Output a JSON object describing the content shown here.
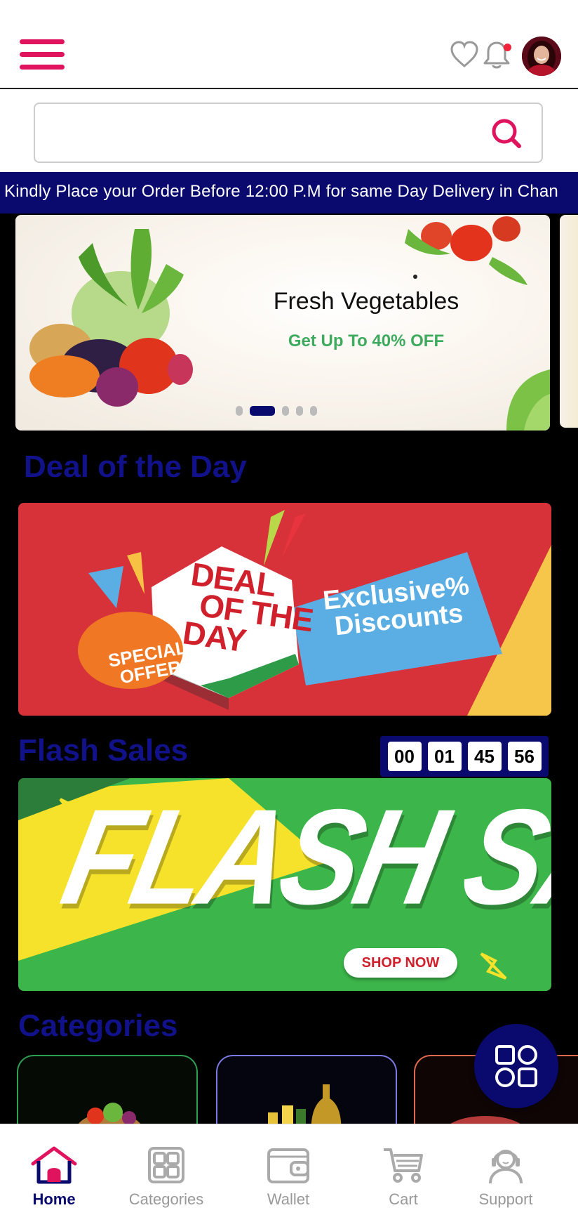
{
  "header": {
    "menu_icon": "hamburger-menu-icon",
    "wishlist_icon": "heart-icon",
    "notification_icon": "bell-icon",
    "avatar_icon": "user-avatar"
  },
  "search": {
    "value": "",
    "placeholder": "",
    "icon": "search-icon"
  },
  "announcement": {
    "text": "Kindly Place your Order Before 12:00 P.M for same Day Delivery in Chan"
  },
  "banner": {
    "title": "Fresh Vegetables",
    "subtitle": "Get Up To 40% OFF",
    "slide_count": 5,
    "active_slide": 2
  },
  "deal_section": {
    "title": "Deal of the Day",
    "banner_headline_lines": [
      "DEAL",
      "OF THE",
      "DAY"
    ],
    "banner_tagline_lines": [
      "Exclusive%",
      "Discounts"
    ],
    "banner_badge_lines": [
      "SPECIAL",
      "OFFER"
    ]
  },
  "flash_section": {
    "title": "Flash Sales",
    "countdown": [
      "00",
      "01",
      "45",
      "56"
    ],
    "banner_headline": "FLASH SALE",
    "banner_cta": "SHOP NOW"
  },
  "categories_section": {
    "title": "Categories"
  },
  "fab": {
    "icon": "grid-icon"
  },
  "bottom_nav": {
    "items": [
      {
        "label": "Home",
        "icon": "home-icon",
        "active": true
      },
      {
        "label": "Categories",
        "icon": "categories-icon",
        "active": false
      },
      {
        "label": "Wallet",
        "icon": "wallet-icon",
        "active": false
      },
      {
        "label": "Cart",
        "icon": "cart-icon",
        "active": false
      },
      {
        "label": "Support",
        "icon": "support-icon",
        "active": false
      }
    ]
  },
  "colors": {
    "brand_pink": "#e0135e",
    "brand_navy": "#0a0a6e",
    "section_title": "#11118a",
    "offer_green": "#3daa5e"
  }
}
